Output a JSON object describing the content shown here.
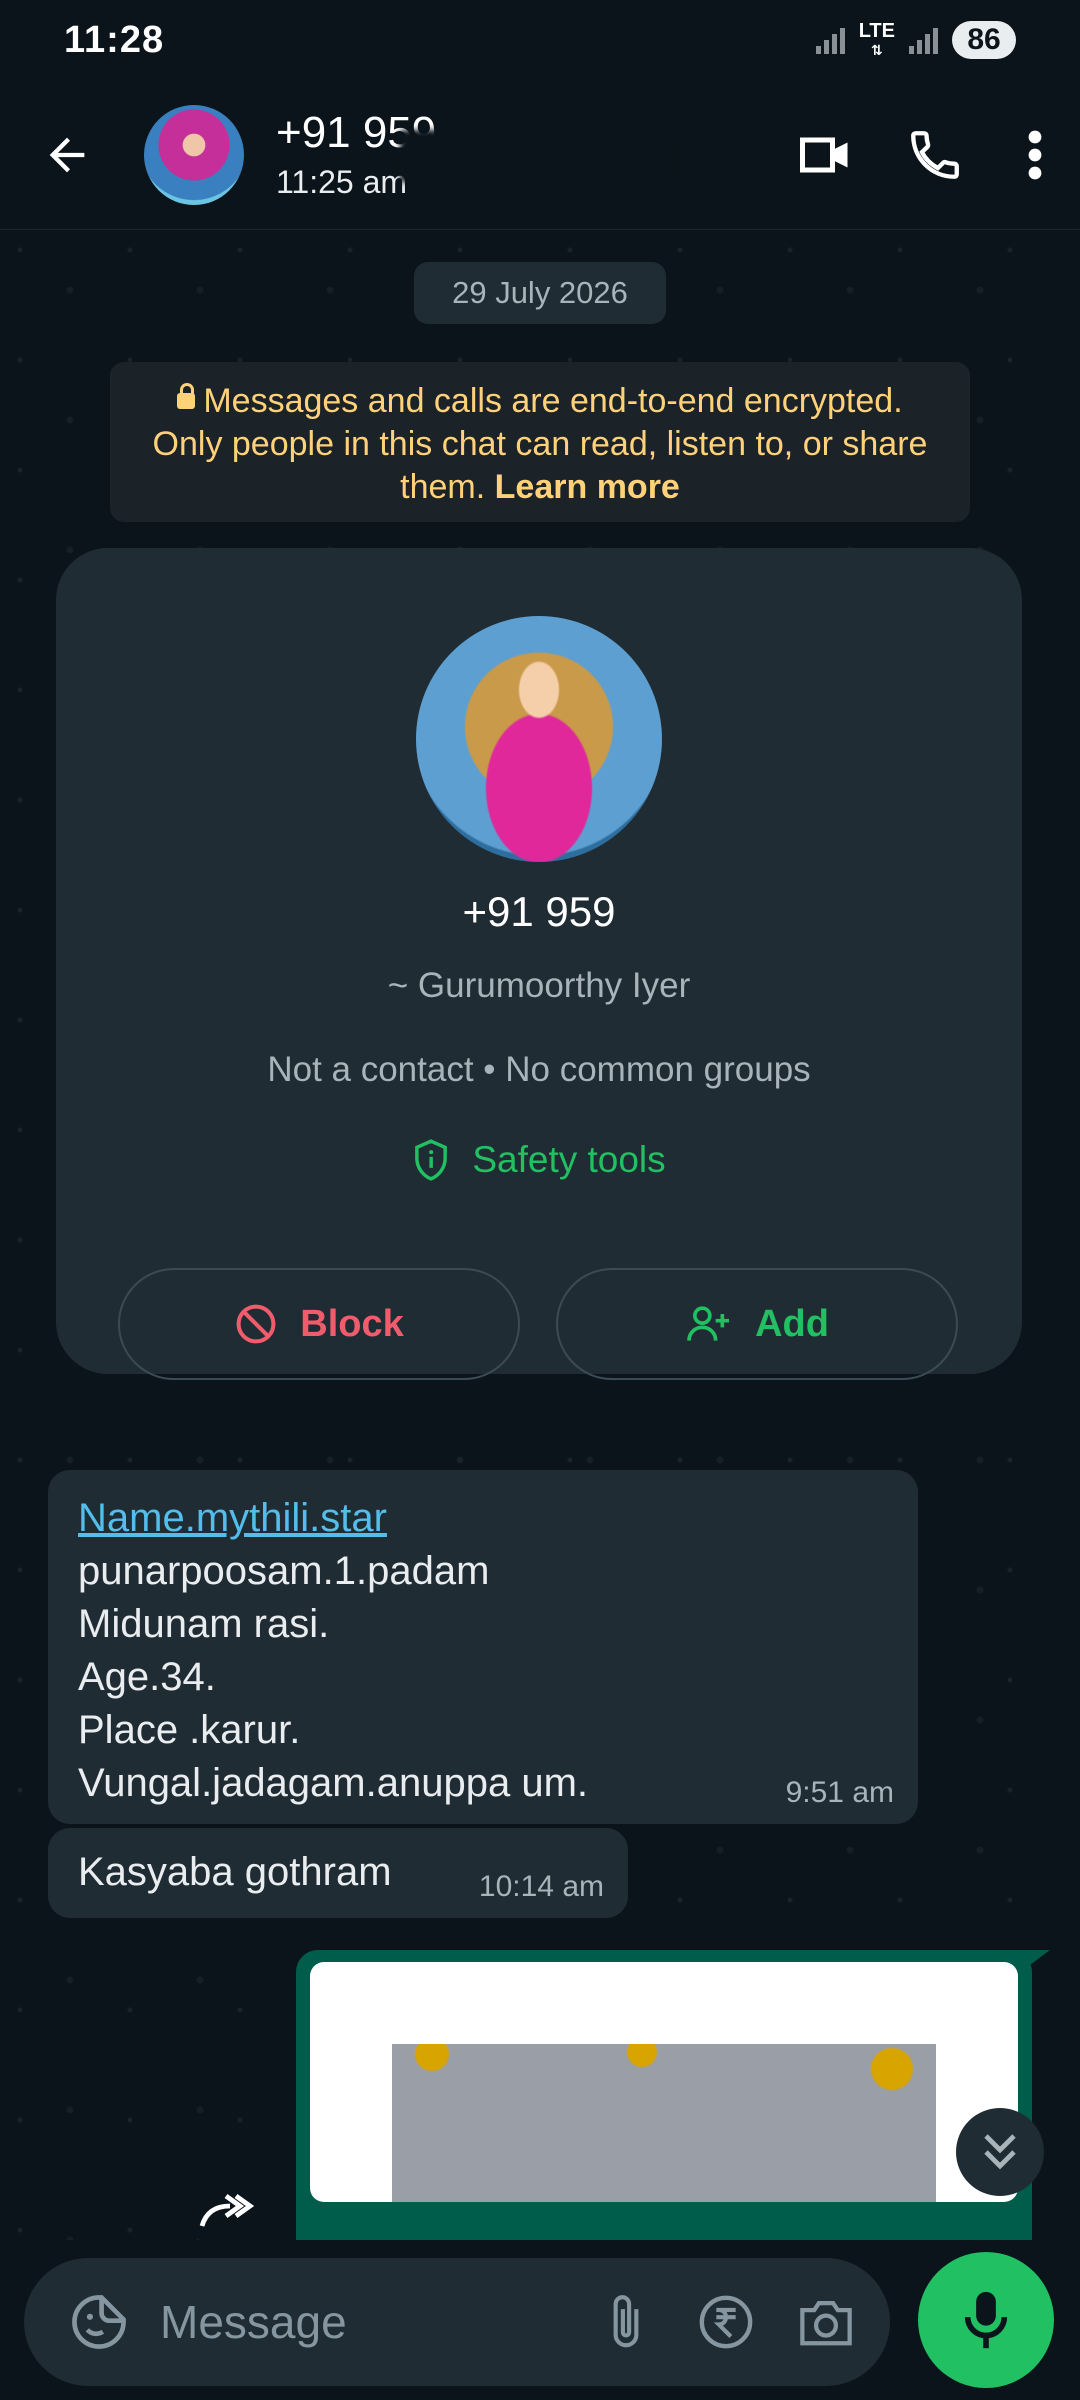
{
  "status_bar": {
    "time": "11:28",
    "network_label": "LTE",
    "battery": "86"
  },
  "header": {
    "contact_number": "+91 959",
    "last_seen": "11:25 am"
  },
  "chat": {
    "date_chip": "29 July 2026",
    "encryption_notice": {
      "text": "Messages and calls are end-to-end encrypted. Only people in this chat can read, listen to, or share them.",
      "learn_more": "Learn more"
    },
    "contact_card": {
      "number": "+91 959",
      "push_name": "~ Gurumoorthy Iyer",
      "meta": "Not a contact • No common groups",
      "safety_tools": "Safety tools",
      "block_label": "Block",
      "add_label": "Add"
    },
    "messages": [
      {
        "direction": "incoming",
        "link": "Name.mythili.star",
        "lines": [
          "punarpoosam.1.padam",
          "Midunam rasi.",
          "Age.34.",
          "Place .karur.",
          "Vungal.jadagam.anuppa um."
        ],
        "time": "9:51 am"
      },
      {
        "direction": "incoming",
        "text": "Kasyaba gothram",
        "time": "10:14 am"
      }
    ]
  },
  "input": {
    "placeholder": "Message"
  },
  "colors": {
    "background": "#0b141a",
    "bubble_incoming": "#202c33",
    "bubble_outgoing": "#005c4b",
    "accent_green": "#21c063",
    "block_red": "#f15c6d",
    "encryption_yellow": "#ffd279",
    "link_blue": "#53bdeb"
  },
  "icons": [
    "back-arrow-icon",
    "video-call-icon",
    "phone-icon",
    "more-vert-icon",
    "lock-icon",
    "shield-icon",
    "block-icon",
    "add-person-icon",
    "forward-icon",
    "double-chevron-down-icon",
    "sticker-icon",
    "attach-icon",
    "rupee-icon",
    "camera-icon",
    "mic-icon"
  ]
}
